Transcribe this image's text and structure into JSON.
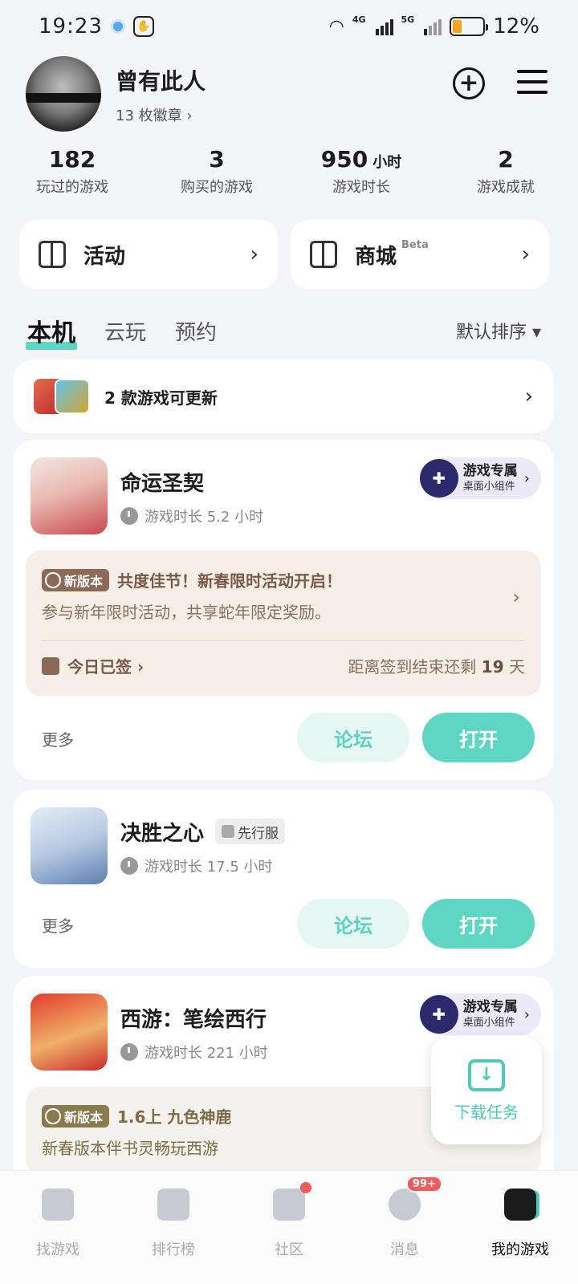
{
  "status_bar": {
    "time": "19:23",
    "net1": "4G",
    "net2": "5G",
    "battery": "12%"
  },
  "profile": {
    "name": "曾有此人",
    "badges": "13 枚徽章 ›"
  },
  "stats": [
    {
      "value": "182",
      "unit": "",
      "label": "玩过的游戏"
    },
    {
      "value": "3",
      "unit": "",
      "label": "购买的游戏"
    },
    {
      "value": "950",
      "unit": "小时",
      "label": "游戏时长"
    },
    {
      "value": "2",
      "unit": "",
      "label": "游戏成就"
    }
  ],
  "entries": {
    "activity": "活动",
    "store": "商城",
    "store_tag": "Beta"
  },
  "tabs": {
    "local": "本机",
    "cloud": "云玩",
    "reserve": "预约",
    "sort": "默认排序 ▾"
  },
  "update_card": {
    "text": "2 款游戏可更新"
  },
  "games": [
    {
      "name": "命运圣契",
      "playtime": "游戏时长 5.2 小时",
      "widget": {
        "title": "游戏专属",
        "sub": "桌面小组件"
      },
      "promo": {
        "tag": "新版本",
        "title": "共度佳节！新春限时活动开启！",
        "desc": "参与新年限时活动，共享蛇年限定奖励。",
        "signed": "今日已签 ›",
        "countdown_prefix": "距离签到结束还剩",
        "countdown_days": "19",
        "countdown_suffix": "天"
      }
    },
    {
      "name": "决胜之心",
      "tag": "先行服",
      "playtime": "游戏时长 17.5 小时"
    },
    {
      "name": "西游：笔绘西行",
      "playtime": "游戏时长 221 小时",
      "widget": {
        "title": "游戏专属",
        "sub": "桌面小组件"
      },
      "promo": {
        "tag": "新版本",
        "title": "1.6上 九色神鹿",
        "desc": "新春版本伴书灵畅玩西游"
      }
    }
  ],
  "actions": {
    "more": "更多",
    "forum": "论坛",
    "open": "打开"
  },
  "float_download": {
    "label": "下载任务"
  },
  "navbar": [
    {
      "label": "找游戏",
      "icon": "find-game-icon"
    },
    {
      "label": "排行榜",
      "icon": "ranking-icon"
    },
    {
      "label": "社区",
      "icon": "community-icon"
    },
    {
      "label": "消息",
      "icon": "message-icon",
      "badge": "99+"
    },
    {
      "label": "我的游戏",
      "icon": "my-games-icon"
    }
  ],
  "colors": {
    "accent": "#5fd6c4",
    "promo_bg": "#f6efe8"
  }
}
